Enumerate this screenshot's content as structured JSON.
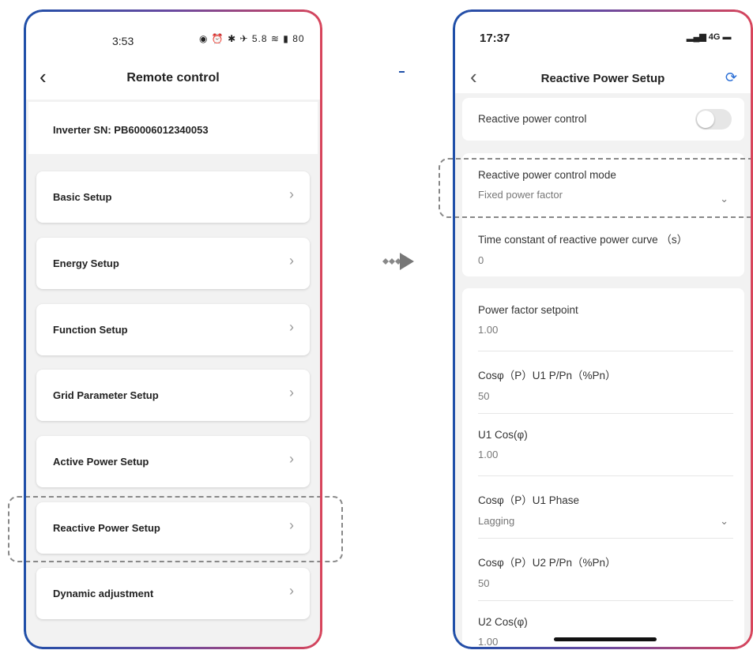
{
  "left_phone": {
    "status_time": "3:53",
    "status_icons_text": "◉ ⏰ ✱ ✈ 5.8 ≋ ▮ 80",
    "battery": "80",
    "header_title": "Remote control",
    "serial": "Inverter SN: PB60006012340053",
    "menu": [
      {
        "label": "Basic Setup"
      },
      {
        "label": "Energy Setup"
      },
      {
        "label": "Function Setup"
      },
      {
        "label": "Grid Parameter Setup"
      },
      {
        "label": "Active Power Setup"
      },
      {
        "label": "Reactive Power Setup"
      },
      {
        "label": "Dynamic adjustment"
      }
    ],
    "highlighted_item": "Reactive Power Setup"
  },
  "right_phone": {
    "status_time": "17:37",
    "network": "4G",
    "header_title": "Reactive Power Setup",
    "toggle": {
      "label": "Reactive power control",
      "state": "off"
    },
    "control_mode": {
      "label": "Reactive power control mode",
      "value": "Fixed power factor"
    },
    "time_constant": {
      "label": "Time constant of reactive power curve （s）",
      "value": "0"
    },
    "params": [
      {
        "label": "Power factor setpoint",
        "value": "1.00"
      },
      {
        "label": "Cosφ（P）U1 P/Pn（%Pn）",
        "value": "50"
      },
      {
        "label": "U1 Cos(φ)",
        "value": "1.00"
      },
      {
        "label": "Cosφ（P）U1 Phase",
        "value": "Lagging"
      },
      {
        "label": "Cosφ（P）U2 P/Pn（%Pn）",
        "value": "50"
      },
      {
        "label": "U2 Cos(φ)",
        "value": "1.00"
      }
    ]
  },
  "colors": {
    "frame_left": "#1f4fa8",
    "frame_right": "#d8455b",
    "accent": "#2b6fd6"
  }
}
